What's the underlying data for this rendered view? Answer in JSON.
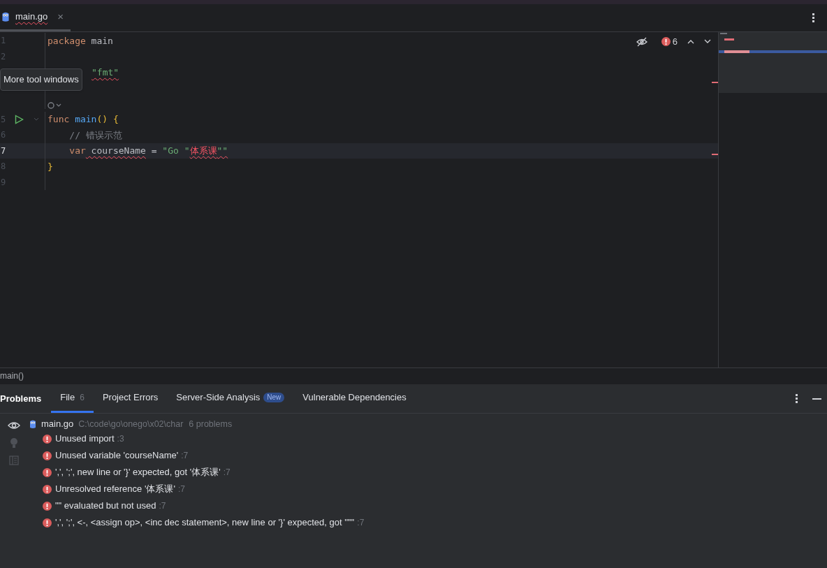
{
  "editor_tabs": [
    {
      "label": "main.go",
      "selected": true,
      "error": true,
      "close": "×"
    }
  ],
  "editor_toolbar": {
    "error_count": "6"
  },
  "code_lines": [
    {
      "number": "1",
      "current": false,
      "tokens": [
        {
          "text": "package",
          "kind": "keyword"
        },
        {
          "text": " main",
          "kind": "plain"
        }
      ]
    },
    {
      "number": "2",
      "current": false
    },
    {
      "covered": true,
      "current": false,
      "tokens": [
        {
          "text": "\"fmt\"",
          "kind": "string",
          "error": true
        }
      ]
    },
    {
      "kind": "inlay",
      "current": false
    },
    {
      "number": "5",
      "current": false,
      "run": true,
      "fold": true,
      "tokens": [
        {
          "text": "func",
          "kind": "keyword"
        },
        {
          "text": " main",
          "kind": "function"
        },
        {
          "text": "()",
          "kind": "brace"
        },
        {
          "text": " {",
          "kind": "brace"
        }
      ]
    },
    {
      "number": "6",
      "current": false,
      "tokens": [
        {
          "text": "    // 错误示范",
          "kind": "comment"
        }
      ]
    },
    {
      "number": "7",
      "current": true,
      "tokens": [
        {
          "text": "    var",
          "kind": "keyword"
        },
        {
          "text": " courseName",
          "kind": "plain",
          "error": true
        },
        {
          "text": " =",
          "kind": "plain"
        },
        {
          "text": " \"Go \"",
          "kind": "string"
        },
        {
          "text": "体系课",
          "kind": "invalid",
          "error": true
        },
        {
          "text": "\"\"",
          "kind": "string",
          "error": true
        }
      ]
    },
    {
      "number": "8",
      "current": false,
      "tokens": [
        {
          "text": "}",
          "kind": "brace"
        }
      ]
    },
    {
      "number": "9",
      "current": false
    }
  ],
  "tooltip": "More tool windows",
  "breadcrumb": "main()",
  "problems_panel": {
    "title": "Problems",
    "tabs": [
      {
        "label": "File",
        "count": "6",
        "selected": true
      },
      {
        "label": "Project Errors",
        "selected": false
      },
      {
        "label": "Server-Side Analysis",
        "badge": "New",
        "selected": false
      },
      {
        "label": "Vulnerable Dependencies",
        "selected": false
      }
    ],
    "file": {
      "name": "main.go",
      "path": "C:\\code\\go\\onego\\x02\\char",
      "summary": "6 problems"
    },
    "problems": [
      {
        "message": "Unused import",
        "line": ":3"
      },
      {
        "message": "Unused variable 'courseName'",
        "line": ":7"
      },
      {
        "message": "',', ';', new line or '}' expected, got '体系课'",
        "line": ":7"
      },
      {
        "message": "Unresolved reference '体系课'",
        "line": ":7"
      },
      {
        "message": "\"\" evaluated but not used",
        "line": ":7"
      },
      {
        "message": "',', ';', <-, <assign op>, <inc dec statement>, new line or '}' expected, got '\"\"'",
        "line": ":7"
      }
    ]
  }
}
